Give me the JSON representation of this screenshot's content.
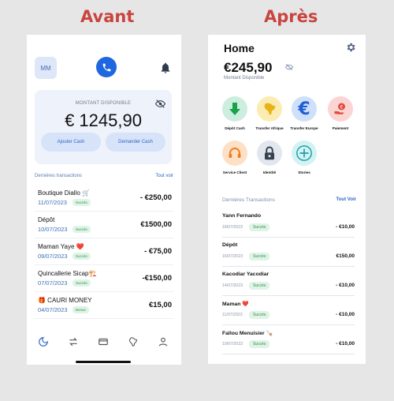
{
  "headings": {
    "before": "Avant",
    "after": "Après"
  },
  "before": {
    "avatar": "MM",
    "balance_label": "MONTANT DISPONIBLE",
    "balance": "€ 1245,90",
    "add_cash": "Ajouter Cash",
    "request_cash": "Demander Cash",
    "transactions_title": "Dernières transactions",
    "see_all": "Tout voir",
    "transactions": [
      {
        "name": "Boutique Diallo 🛒",
        "date": "11/07/2023",
        "badge": "Succès",
        "amount": "- €250,00"
      },
      {
        "name": "Dépôt",
        "date": "10/07/2023",
        "badge": "Succès",
        "amount": "€1500,00"
      },
      {
        "name": "Maman Yaye ❤️",
        "date": "09/07/2023",
        "badge": "Succès",
        "amount": "- €75,00"
      },
      {
        "name": "Quincallerie Sicap🏗️",
        "date": "07/07/2023",
        "badge": "Succès",
        "amount": "-€150,00"
      },
      {
        "name": "🎁 CAURI MONEY",
        "date": "04/07/2023",
        "badge": "Bonus",
        "amount": "€15,00"
      }
    ],
    "nav_icons": [
      "home-icon",
      "transfer-icon",
      "card-icon",
      "africa-icon",
      "profile-icon"
    ]
  },
  "after": {
    "title": "Home",
    "balance": "€245,90",
    "balance_sub": "Montant Disponible",
    "services": [
      {
        "label": "Dépôt Cash",
        "icon": "deposit-icon",
        "bg": "#cdeede",
        "fg": "#18a34a"
      },
      {
        "label": "Transfer Afrique",
        "icon": "africa-icon",
        "bg": "#fbecb4",
        "fg": "#e9b318"
      },
      {
        "label": "Transfer Europe",
        "icon": "euro-icon",
        "bg": "#cfe0fb",
        "fg": "#1e5fd6"
      },
      {
        "label": "Paiement",
        "icon": "payment-icon",
        "bg": "#fbd5d3",
        "fg": "#e24b3c"
      },
      {
        "label": "Service Client",
        "icon": "headset-icon",
        "bg": "#fde0c6",
        "fg": "#f07d1d"
      },
      {
        "label": "Identité",
        "icon": "lock-icon",
        "bg": "#e2e7ef",
        "fg": "#36404f"
      },
      {
        "label": "Stories",
        "icon": "plus-icon",
        "bg": "#d4f2f3",
        "fg": "#1aa2a8"
      }
    ],
    "transactions_title": "Dernières Transactions",
    "see_all": "Tout Voir",
    "transactions": [
      {
        "name": "Yann Fernando",
        "date": "18/07/2023",
        "badge": "Succès",
        "amount": "- €10,00"
      },
      {
        "name": "Dépôt",
        "date": "16/07/2023",
        "badge": "Succès",
        "amount": "€150,00"
      },
      {
        "name": "Kacodiar Yacodiar",
        "date": "14/07/2023",
        "badge": "Succès",
        "amount": "- €10,00"
      },
      {
        "name": "Maman ❤️",
        "date": "11/07/2023",
        "badge": "Succès",
        "amount": "- €10,00"
      },
      {
        "name": "Fallou Menuisier 🪚",
        "date": "10/07/2023",
        "badge": "Succès",
        "amount": "- €10,00"
      }
    ]
  }
}
